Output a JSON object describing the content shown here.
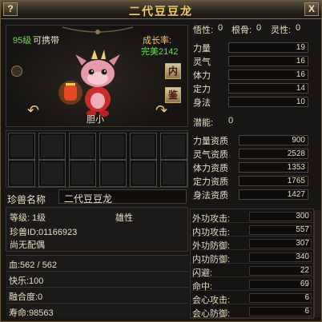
{
  "window": {
    "title": "二代豆豆龙",
    "help_label": "?",
    "close_label": "X"
  },
  "pet": {
    "level_text": "95级",
    "carry_text": "可携带",
    "growth_label": "成长率:",
    "growth_value_text": "完美2142",
    "personality": "胆小",
    "name_label": "珍兽名称",
    "name": "二代豆豆龙"
  },
  "buttons": {
    "inner": "内",
    "appraise": "鉴"
  },
  "top_attrs": [
    {
      "label": "悟性:",
      "value": "0"
    },
    {
      "label": "根骨:",
      "value": "0"
    },
    {
      "label": "灵性:",
      "value": "0"
    }
  ],
  "base_stats": [
    {
      "label": "力量",
      "value": "19"
    },
    {
      "label": "灵气",
      "value": "16"
    },
    {
      "label": "体力",
      "value": "16"
    },
    {
      "label": "定力",
      "value": "14"
    },
    {
      "label": "身法",
      "value": "10"
    }
  ],
  "potential": {
    "label": "潜能:",
    "value": "0"
  },
  "aptitudes": [
    {
      "label": "力量资质",
      "value": "900"
    },
    {
      "label": "灵气资质",
      "value": "2528"
    },
    {
      "label": "体力资质",
      "value": "1353"
    },
    {
      "label": "定力资质",
      "value": "1765"
    },
    {
      "label": "身法资质",
      "value": "1427"
    }
  ],
  "info": {
    "level_label": "等级:",
    "level_value": "1级",
    "gender": "雄性",
    "pet_id": "珍兽ID:01166923",
    "spouse": "尚无配偶"
  },
  "vitals": [
    {
      "label": "血",
      "value": ":562 / 562"
    },
    {
      "label": "快乐",
      "value": ":100"
    },
    {
      "label": "融合度",
      "value": ":0"
    },
    {
      "label": "寿命",
      "value": ":98563"
    }
  ],
  "combat": [
    {
      "label": "外功攻击:",
      "value": "300"
    },
    {
      "label": "内功攻击:",
      "value": "557"
    },
    {
      "label": "外功防御:",
      "value": "307"
    },
    {
      "label": "内功防御:",
      "value": "340"
    },
    {
      "label": "闪避:",
      "value": "22"
    },
    {
      "label": "命中:",
      "value": "69"
    },
    {
      "label": "会心攻击:",
      "value": "6"
    },
    {
      "label": "会心防御:",
      "value": "6"
    }
  ]
}
